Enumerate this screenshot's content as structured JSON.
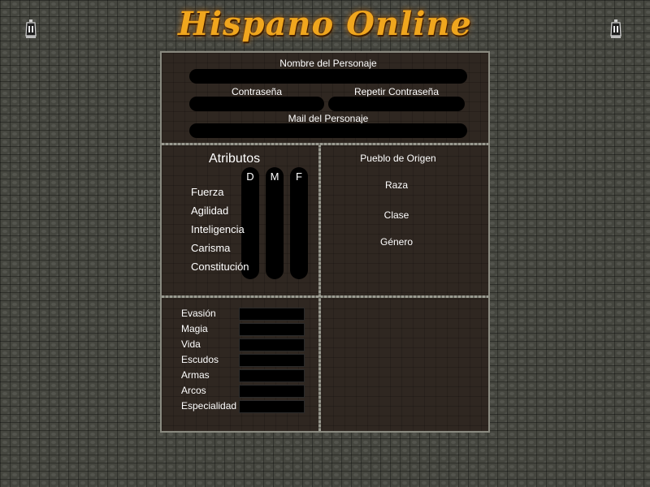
{
  "header": {
    "logo_text": "Hispano Online",
    "logo_color": "#f0a61e",
    "left_icon": "lantern-icon",
    "right_icon": "lantern-icon"
  },
  "account": {
    "name_label": "Nombre del Personaje",
    "password_label": "Contraseña",
    "repeat_password_label": "Repetir Contraseña",
    "mail_label": "Mail del Personaje",
    "name_value": "",
    "password_value": "",
    "repeat_password_value": "",
    "mail_value": ""
  },
  "attributes": {
    "title": "Atributos",
    "columns": [
      "D",
      "M",
      "F"
    ],
    "items": [
      "Fuerza",
      "Agilidad",
      "Inteligencia",
      "Carisma",
      "Constitución"
    ]
  },
  "origin": {
    "pueblo_label": "Pueblo de Origen",
    "raza_label": "Raza",
    "clase_label": "Clase",
    "genero_label": "Género"
  },
  "skills": {
    "items": [
      "Evasión",
      "Magia",
      "Vida",
      "Escudos",
      "Armas",
      "Arcos",
      "Especialidad"
    ]
  }
}
